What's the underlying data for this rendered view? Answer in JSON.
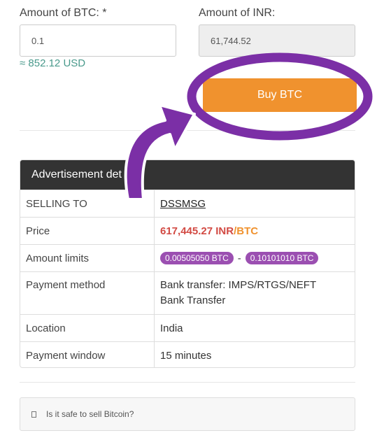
{
  "form": {
    "btc_label": "Amount of BTC: *",
    "btc_value": "0.1",
    "usd_equiv": "≈ 852.12 USD",
    "inr_label": "Amount of INR:",
    "inr_value": "61,744.52",
    "buy_button": "Buy BTC"
  },
  "details": {
    "header": "Advertisement det",
    "rows": [
      {
        "label": "SELLING TO",
        "value": "DSSMSG"
      },
      {
        "label": "Price",
        "value_inr": "617,445.27 INR",
        "value_btc": "BTC",
        "sep": "/"
      },
      {
        "label": "Amount limits",
        "min": "0.00505050 BTC",
        "sep": "-",
        "max": "0.10101010 BTC"
      },
      {
        "label": "Payment method",
        "line1": "Bank transfer: IMPS/RTGS/NEFT",
        "line2": "Bank Transfer"
      },
      {
        "label": "Location",
        "value": "India"
      },
      {
        "label": "Payment window",
        "value": "15 minutes"
      }
    ]
  },
  "faq": {
    "icon": "document-icon",
    "question": "Is it safe to sell Bitcoin?"
  },
  "colors": {
    "button": "#f0922e",
    "annotation": "#7b2fa6",
    "price_inr": "#d24a43",
    "badge": "#9b4fb1",
    "header_bg": "#333333"
  }
}
